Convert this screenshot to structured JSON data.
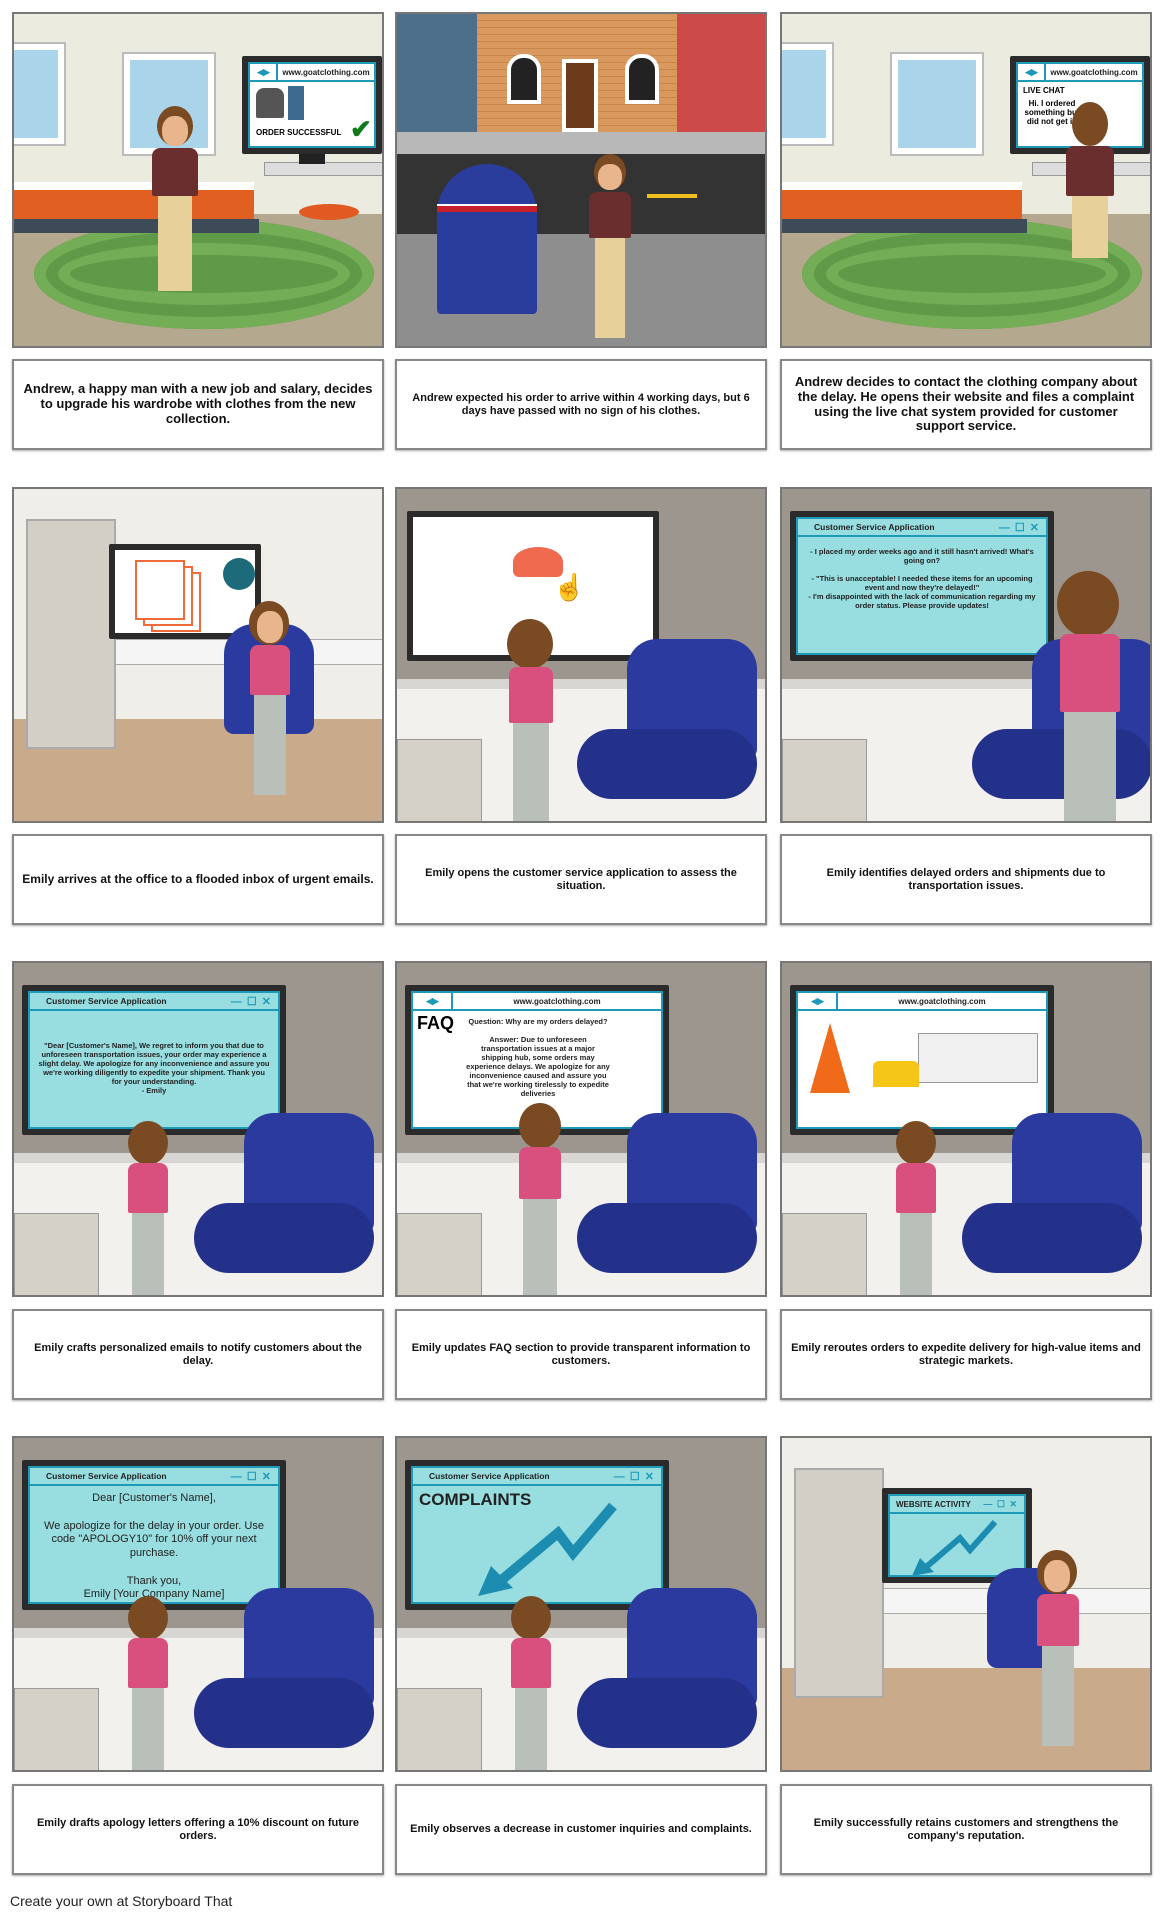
{
  "panels": [
    {
      "caption": "Andrew, a happy man with a new job and salary, decides to upgrade his wardrobe with clothes from the new collection.",
      "screen": {
        "url": "www.goatclothing.com",
        "status": "ORDER SUCCESSFUL"
      }
    },
    {
      "caption": "Andrew expected his order to arrive within 4 working days, but 6 days have passed with no sign of his clothes."
    },
    {
      "caption": "Andrew decides to contact the clothing company about the delay. He opens their website and files a complaint using the live chat system provided for customer support service.",
      "screen": {
        "url": "www.goatclothing.com",
        "heading": "LIVE CHAT",
        "message": "Hi. I ordered something but did not get it."
      }
    },
    {
      "caption": "Emily arrives at the office to a flooded inbox of urgent emails."
    },
    {
      "caption": "Emily opens the customer service application to assess the situation."
    },
    {
      "caption": "Emily identifies delayed orders and shipments due to transportation issues.",
      "screen": {
        "title": "Customer Service Application",
        "lines": [
          "- I placed my order weeks ago and it still hasn't arrived! What's going on?",
          "- \"This is unacceptable! I needed these items for an upcoming event and now they're delayed!\"",
          "- I'm disappointed with the lack of communication regarding my order status. Please provide updates!"
        ]
      }
    },
    {
      "caption": "Emily crafts personalized emails to notify customers about the delay.",
      "screen": {
        "title": "Customer Service Application",
        "message": "\"Dear [Customer's Name], We regret to inform you that due to unforeseen transportation issues, your order may experience a slight delay. We apologize for any inconvenience and assure you we're working diligently to expedite your shipment. Thank you for your understanding.",
        "signature": "- Emily"
      }
    },
    {
      "caption": "Emily updates FAQ section to provide transparent information to customers.",
      "screen": {
        "url": "www.goatclothing.com",
        "heading": "FAQ",
        "question": "Question: Why are my orders delayed?",
        "answer": "Answer: Due to unforeseen transportation issues at a major shipping hub, some orders may experience delays. We apologize for any inconvenience caused and assure you that we're working tirelessly to expedite deliveries"
      }
    },
    {
      "caption": "Emily reroutes orders to expedite delivery for high-value items and strategic markets.",
      "screen": {
        "url": "www.goatclothing.com"
      }
    },
    {
      "caption": "Emily drafts apology letters offering a 10% discount on future orders.",
      "screen": {
        "title": "Customer Service Application",
        "greeting": "Dear [Customer's Name],",
        "body": "We apologize for the delay in your order. Use code \"APOLOGY10\" for 10% off your next purchase.",
        "closing": "Thank you,",
        "signature": "Emily [Your Company Name]"
      }
    },
    {
      "caption": "Emily observes a decrease in customer inquiries and complaints.",
      "screen": {
        "title": "Customer Service Application",
        "heading": "COMPLAINTS"
      }
    },
    {
      "caption": "Emily successfully retains customers and strengthens the company's reputation.",
      "screen": {
        "title": "WEBSITE ACTIVITY"
      }
    }
  ],
  "window_controls": "— ☐ ✕",
  "footer": "Create your own at Storyboard That",
  "colors": {
    "screen_cyan": "#98dde0",
    "accent_blue": "#1c9ab8",
    "emily_shirt": "#d94f7e",
    "chair_blue": "#2b3a9f"
  }
}
